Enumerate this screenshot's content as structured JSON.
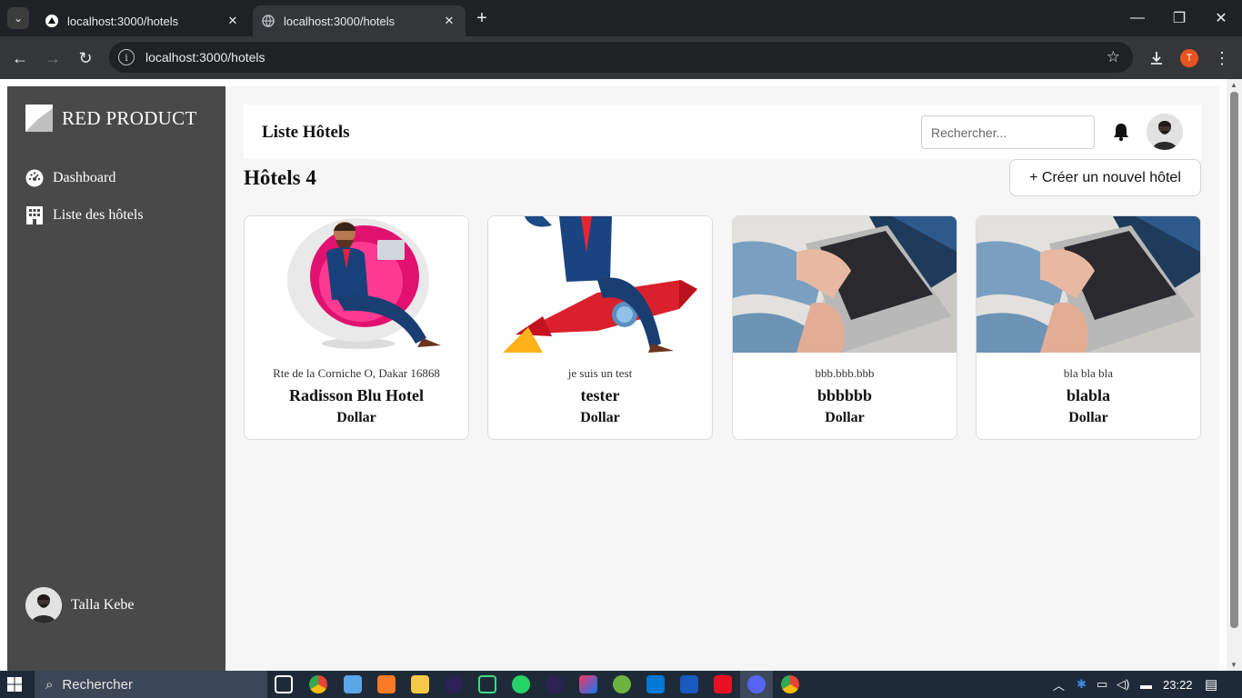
{
  "browser": {
    "tabs": [
      {
        "title": "localhost:3000/hotels",
        "active": false
      },
      {
        "title": "localhost:3000/hotels",
        "active": true
      }
    ],
    "new_tab_symbol": "+",
    "url": "localhost:3000/hotels",
    "profile_initial": "T",
    "profile_color": "#e8531f"
  },
  "sidebar": {
    "brand": "RED PRODUCT",
    "items": [
      {
        "label": "Dashboard",
        "icon": "dashboard-icon"
      },
      {
        "label": "Liste des hôtels",
        "icon": "building-icon"
      }
    ],
    "user_name": "Talla Kebe"
  },
  "header": {
    "title": "Liste Hôtels",
    "search_placeholder": "Rechercher..."
  },
  "content": {
    "count_title": "Hôtels 4",
    "create_button": "+ Créer un nouvel hôtel",
    "hotels": [
      {
        "address": "Rte de la Corniche O, Dakar 16868",
        "name": "Radisson Blu Hotel",
        "currency": "Dollar",
        "image": "man-in-egg-chair"
      },
      {
        "address": "je suis un test",
        "name": "tester",
        "currency": "Dollar",
        "image": "man-on-rocket"
      },
      {
        "address": "bbb.bbb.bbb",
        "name": "bbbbbb",
        "currency": "Dollar",
        "image": "hands-on-laptop"
      },
      {
        "address": "bla bla bla",
        "name": "blabla",
        "currency": "Dollar",
        "image": "hands-on-laptop"
      }
    ]
  },
  "taskbar": {
    "search_placeholder": "Rechercher",
    "time": "23:22"
  },
  "colors": {
    "sidebar_bg": "#494949",
    "main_bg": "#f6f6f6",
    "taskbar_bg": "#1f2a38"
  }
}
